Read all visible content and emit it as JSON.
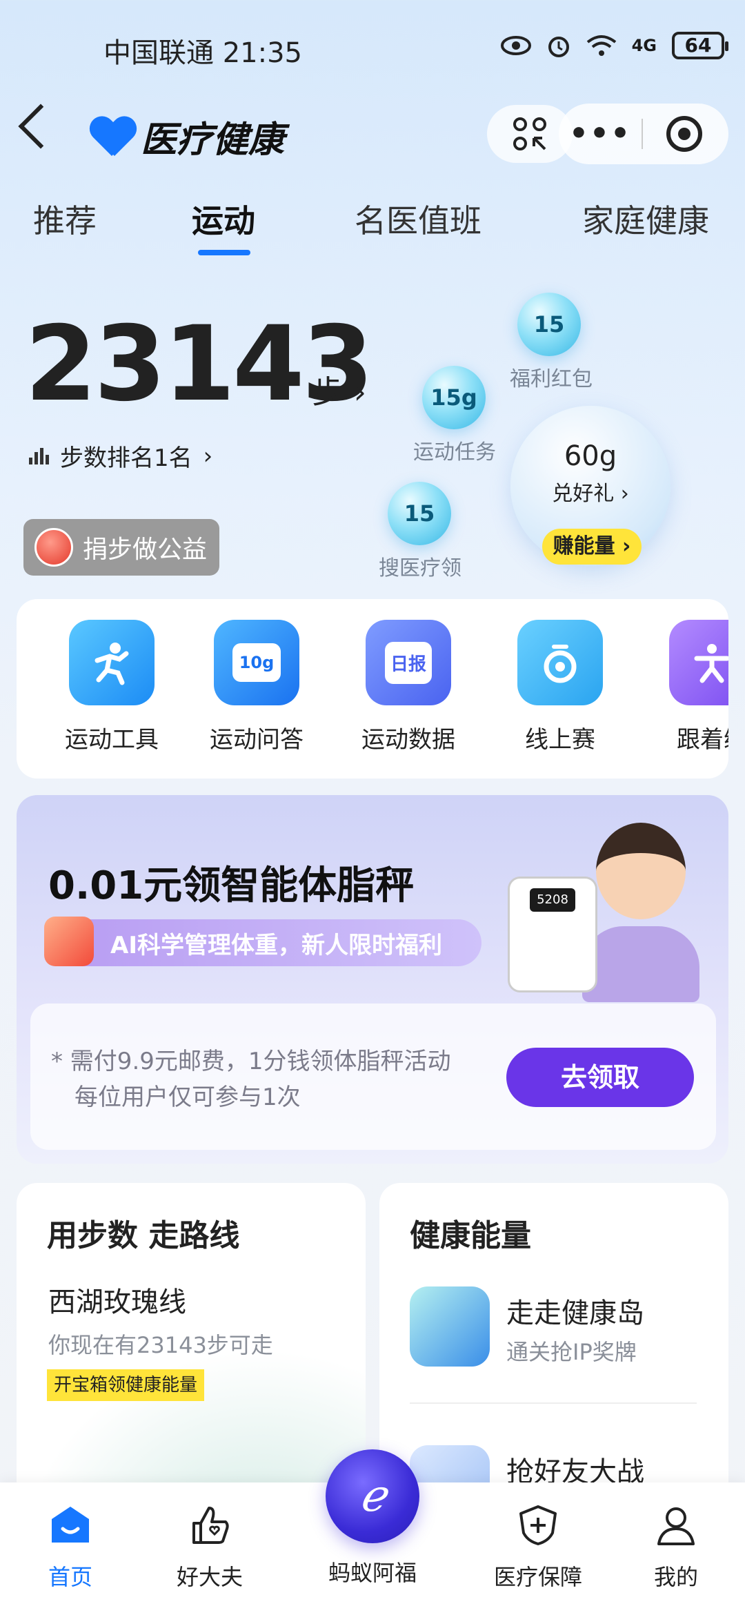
{
  "status_bar": {
    "carrier_time": "中国联通 21:35",
    "battery": "64",
    "signal": "4G"
  },
  "header": {
    "title": "医疗健康"
  },
  "tabs": [
    {
      "label": "推荐"
    },
    {
      "label": "运动",
      "active": true
    },
    {
      "label": "名医值班"
    },
    {
      "label": "家庭健康"
    }
  ],
  "steps": {
    "count": "23143",
    "unit": "步",
    "rank": "步数排名1名",
    "charity": "捐步做公益"
  },
  "bubbles": {
    "welfare": {
      "value": "15",
      "label": "福利红包"
    },
    "task": {
      "value": "15g",
      "label": "运动任务"
    },
    "search": {
      "value": "15",
      "label": "搜医疗领"
    },
    "big": {
      "value": "60g",
      "label": "兑好礼 ›",
      "button": "赚能量 ›"
    }
  },
  "tools": [
    {
      "label": "运动工具",
      "icon": "runner-icon"
    },
    {
      "label": "运动问答",
      "icon": "qa-icon",
      "badge": "10g"
    },
    {
      "label": "运动数据",
      "icon": "daily-report-icon",
      "badge": "日报"
    },
    {
      "label": "线上赛",
      "icon": "online-race-icon"
    },
    {
      "label": "跟着练",
      "icon": "workout-icon"
    }
  ],
  "promo": {
    "title": "0.01元领智能体脂秤",
    "subtitle": "AI科学管理体重，新人限时福利",
    "note_line1": "* 需付9.9元邮费，1分钱领体脂秤活动",
    "note_line2": "每位用户仅可参与1次",
    "button": "去领取",
    "scale_display": "5208"
  },
  "route_card": {
    "title": "用步数 走路线",
    "route": "西湖玫瑰线",
    "sub": "你现在有23143步可走",
    "tag": "开宝箱领健康能量"
  },
  "energy_card": {
    "title": "健康能量",
    "items": [
      {
        "title": "走走健康岛",
        "sub": "通关抢IP奖牌"
      },
      {
        "title": "抢好友大战"
      }
    ]
  },
  "bottom_nav": [
    {
      "label": "首页",
      "icon": "home-icon",
      "active": true
    },
    {
      "label": "好大夫",
      "icon": "thumbs-up-heart-icon"
    },
    {
      "label": "蚂蚁阿福",
      "icon": "afu-logo-icon"
    },
    {
      "label": "医疗保障",
      "icon": "shield-plus-icon"
    },
    {
      "label": "我的",
      "icon": "person-icon"
    }
  ],
  "colors": {
    "accent": "#1677ff",
    "promo_button": "#6a35e8",
    "yellow_tag": "#ffe43a"
  }
}
